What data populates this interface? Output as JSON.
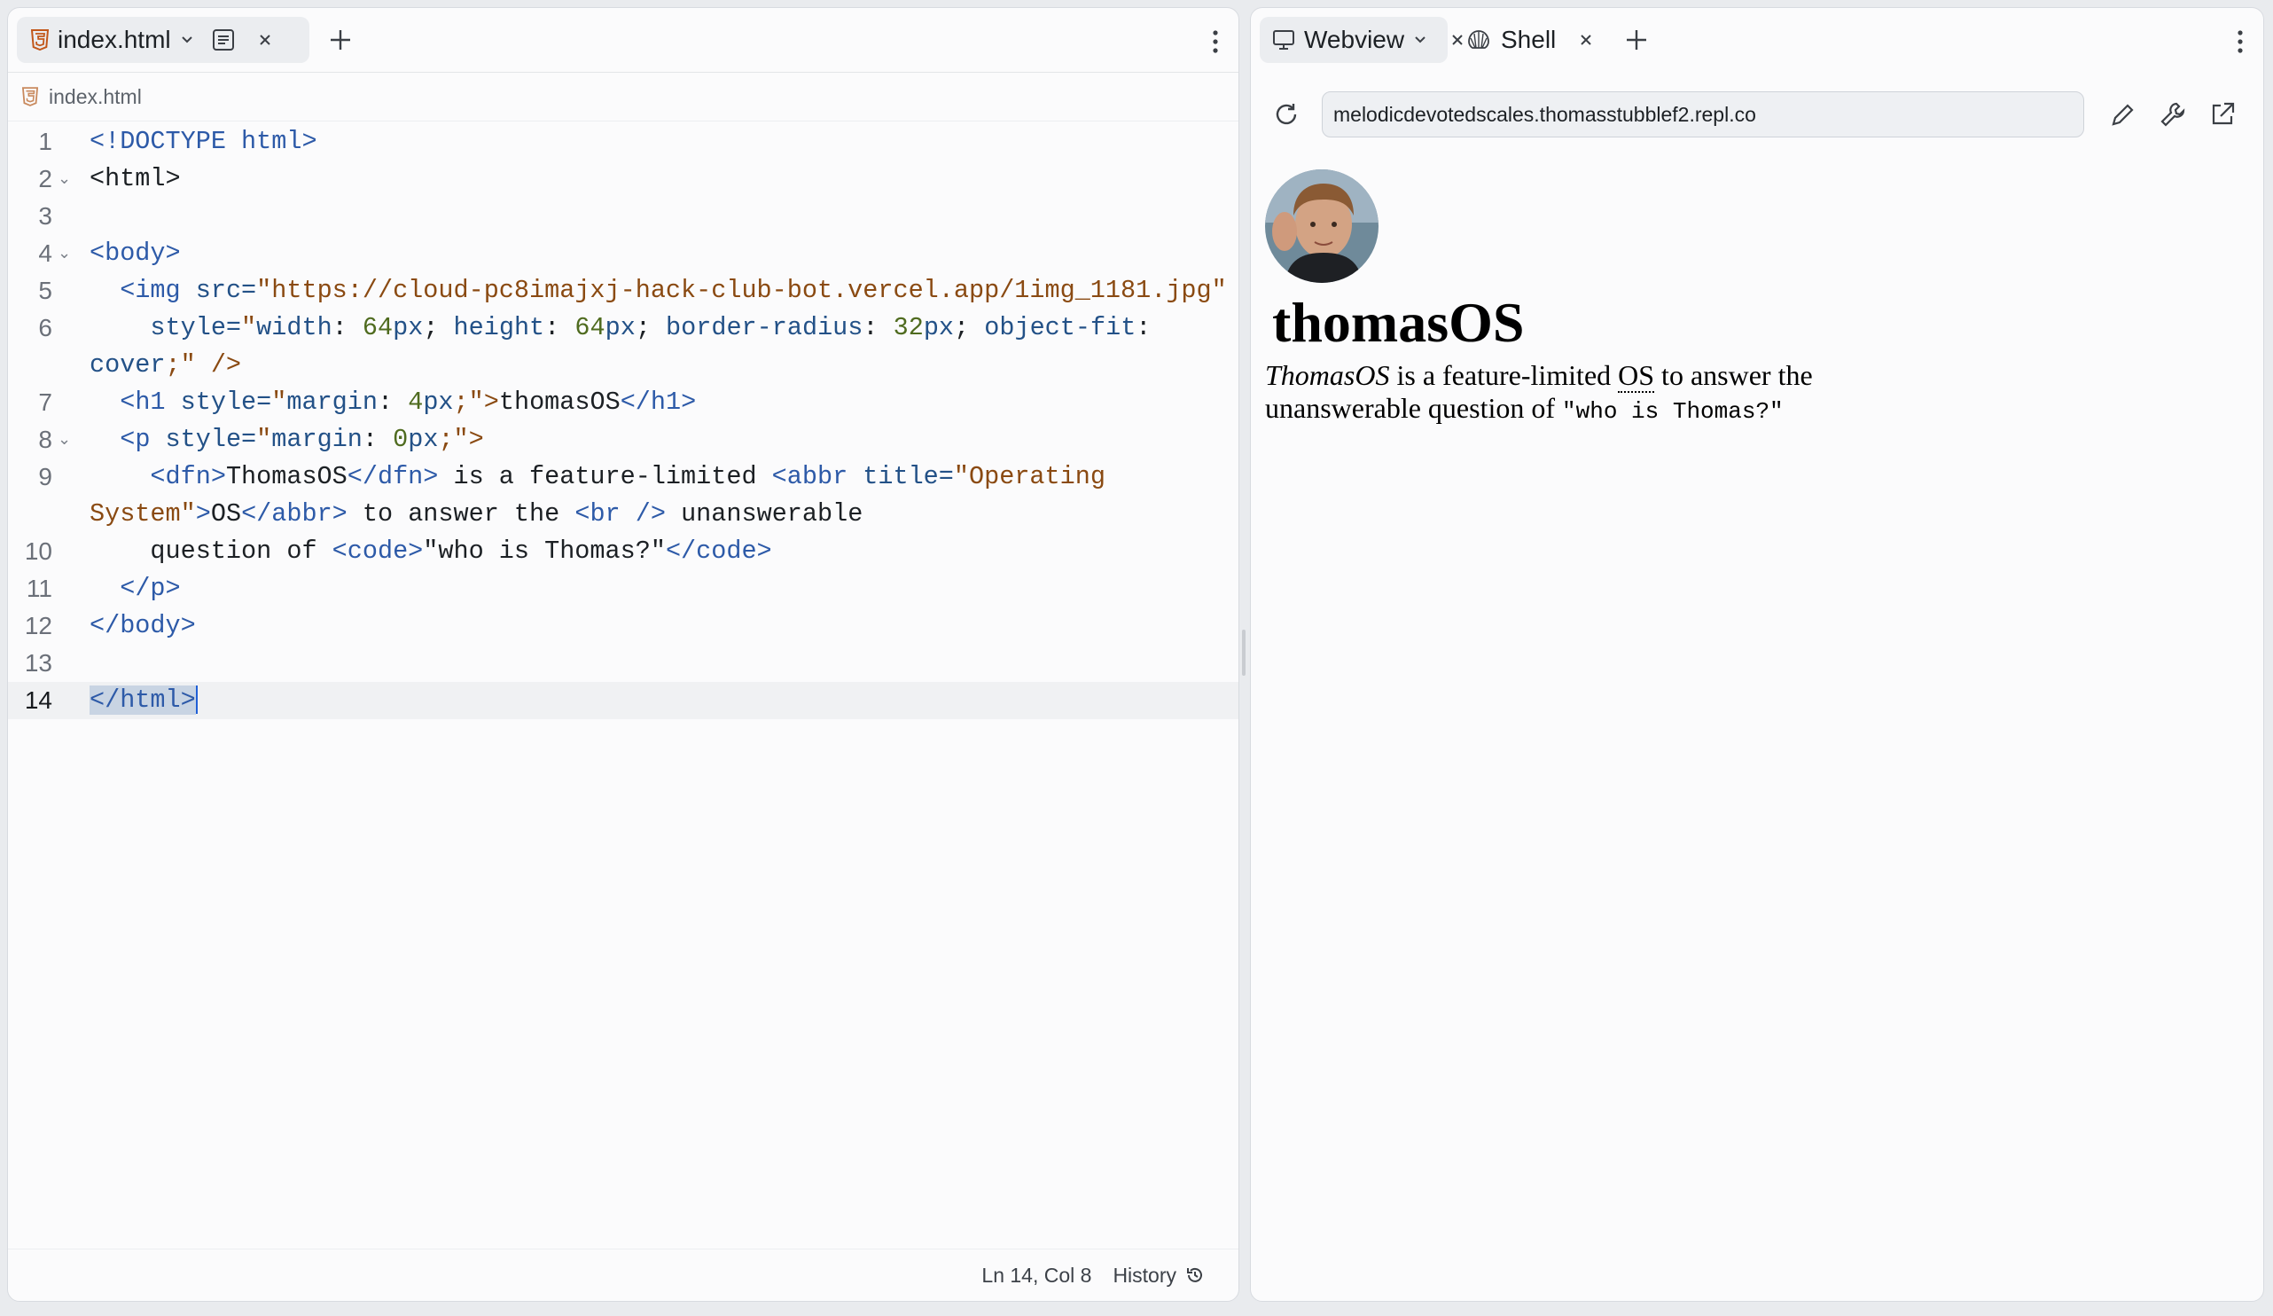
{
  "editor": {
    "tab_label": "index.html",
    "breadcrumb": "index.html",
    "lines": [
      {
        "n": "1"
      },
      {
        "n": "2"
      },
      {
        "n": "3"
      },
      {
        "n": "4"
      },
      {
        "n": "5"
      },
      {
        "n": "6"
      },
      {
        "n": "7"
      },
      {
        "n": "8"
      },
      {
        "n": "9"
      },
      {
        "n": "10"
      },
      {
        "n": "11"
      },
      {
        "n": "12"
      },
      {
        "n": "13"
      },
      {
        "n": "14"
      }
    ],
    "code": {
      "l1_doctype": "<!DOCTYPE html>",
      "l2_html": "<html>",
      "l4_body": "<body>",
      "l5_img": "<img",
      "l5_src_attr": " src=",
      "l5_src_val": "\"https://cloud-pc8imajxj-hack-club-bot.vercel.app/1img_1181.jpg\"",
      "l6_style_attr": "style=",
      "l6_q": "\"",
      "l6_width": "width",
      "l6_colon": ": ",
      "l6_64a": "64",
      "l6_px": "px",
      "l6_semi": "; ",
      "l6_height": "height",
      "l6_64b": "64",
      "l6_radius": "border-radius",
      "l6_32": "32",
      "l6_objfit": "object-fit",
      "l6_colon_end": ":",
      "l6b_cover": "cover",
      "l6b_end": ";\" />",
      "l7_h1_open": "<h1",
      "l7_style": " style=",
      "l7_q": "\"",
      "l7_margin": "margin",
      "l7_4": "4",
      "l7_px": "px",
      "l7_end": ";\">",
      "l7_text": "thomasOS",
      "l7_h1_close": "</h1>",
      "l8_p_open": "<p",
      "l8_0": "0",
      "l9_dfn_open": "<dfn>",
      "l9_dfn_text": "ThomasOS",
      "l9_dfn_close": "</dfn>",
      "l9_mid": " is a feature-limited ",
      "l9_abbr_open": "<abbr",
      "l9_title_attr": " title=",
      "l9_title_val_a": "\"Operating",
      "l9b_title_val_b": "System\"",
      "l9b_gt": ">",
      "l9b_os": "OS",
      "l9b_abbr_close": "</abbr>",
      "l9b_mid": " to answer the ",
      "l9b_br": "<br />",
      "l9b_end": " unanswerable",
      "l10_text": "question of ",
      "l10_code_open": "<code>",
      "l10_code_text": "\"who is Thomas?\"",
      "l10_code_close": "</code>",
      "l11_p_close": "</p>",
      "l12_body_close": "</body>",
      "l14_html_a": "</html",
      "l14_html_b": ">"
    },
    "status": {
      "position": "Ln 14, Col 8",
      "history": "History"
    }
  },
  "webview": {
    "tabs": [
      {
        "label": "Webview"
      },
      {
        "label": "Shell"
      }
    ],
    "url": "melodicdevotedscales.thomasstubblef2.repl.co",
    "page": {
      "h1": "thomasOS",
      "dfn": "ThomasOS",
      "text_a": " is a feature-limited ",
      "abbr": "OS",
      "abbr_title": "Operating System",
      "text_b": " to answer the",
      "text_c": "unanswerable question of ",
      "code": "\"who is Thomas?\""
    }
  },
  "colors": {
    "tag": "#2d5aa8",
    "string": "#8a4a12",
    "number": "#4f6b1f",
    "caret": "#1f5fd6"
  }
}
